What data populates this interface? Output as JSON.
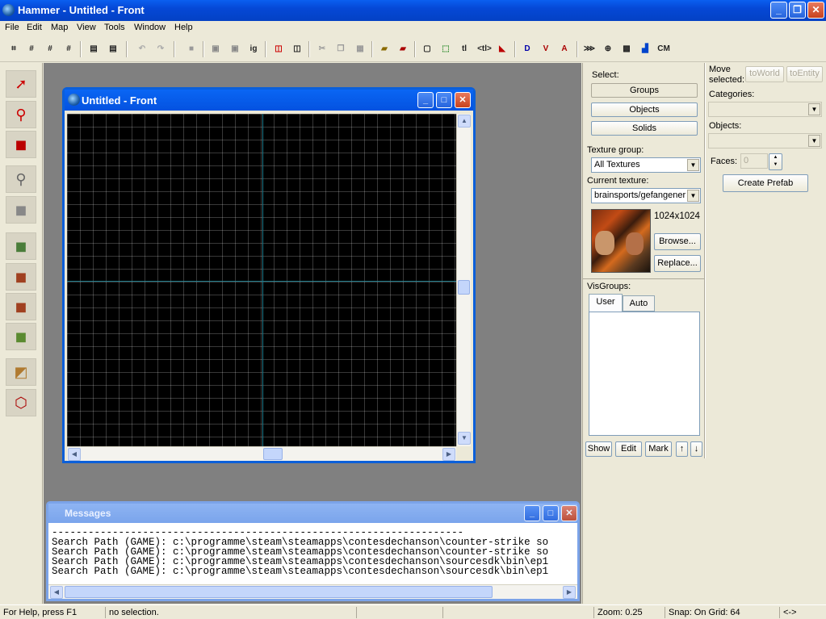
{
  "app": {
    "title": "Hammer - Untitled - Front"
  },
  "menu": [
    "File",
    "Edit",
    "Map",
    "View",
    "Tools",
    "Window",
    "Help"
  ],
  "toolbar": {
    "items": [
      "grid-icon",
      "grid-size-icon",
      "grid-smaller-icon",
      "grid-larger-icon",
      "group-icon",
      "ungroup-icon",
      "undo-icon",
      "redo-icon",
      "carve-icon",
      "hide-icon",
      "show-icon",
      "ig",
      "clip-icon",
      "vertex-icon",
      "cut-icon",
      "copy-icon",
      "paste-icon",
      "texture-lock-icon",
      "texture-scale-icon",
      "box-select-icon",
      "handle-select-icon",
      "tl",
      "tlr",
      "flip-icon",
      "d-icon",
      "v-icon",
      "a-icon",
      "overlay-icon",
      "sphere-icon",
      "wire-icon",
      "cube-icon"
    ],
    "ig_label": "ig",
    "tl_label": "tl",
    "tlr_label": "<tl>",
    "cm_label": "CM"
  },
  "map_window": {
    "title": "Untitled - Front"
  },
  "messages": {
    "title": "Messages",
    "lines": [
      "--------------------------------------------------------------------",
      "Search Path (GAME): c:\\programme\\steam\\steamapps\\contesdechanson\\counter-strike so",
      "Search Path (GAME): c:\\programme\\steam\\steamapps\\contesdechanson\\counter-strike so",
      "Search Path (GAME): c:\\programme\\steam\\steamapps\\contesdechanson\\sourcesdk\\bin\\ep1",
      "Search Path (GAME): c:\\programme\\steam\\steamapps\\contesdechanson\\sourcesdk\\bin\\ep1"
    ]
  },
  "select": {
    "label": "Select:",
    "groups": "Groups",
    "objects": "Objects",
    "solids": "Solids"
  },
  "texture": {
    "group_label": "Texture group:",
    "group_value": "All Textures",
    "current_label": "Current texture:",
    "current_value": "brainsports/gefangener",
    "size": "1024x1024",
    "browse": "Browse...",
    "replace": "Replace..."
  },
  "visgroups": {
    "label": "VisGroups:",
    "tab_user": "User",
    "tab_auto": "Auto",
    "show": "Show",
    "edit": "Edit",
    "mark": "Mark",
    "up": "↑",
    "down": "↓"
  },
  "move": {
    "label1": "Move",
    "label2": "selected:",
    "to_world": "toWorld",
    "to_entity": "toEntity",
    "categories": "Categories:",
    "objects": "Objects:",
    "faces": "Faces:",
    "faces_value": "0",
    "create_prefab": "Create Prefab"
  },
  "status": {
    "help": "For Help, press F1",
    "selection": "no selection.",
    "zoom": "Zoom: 0.25",
    "snap": "Snap: On Grid: 64",
    "arrows": "<->"
  }
}
